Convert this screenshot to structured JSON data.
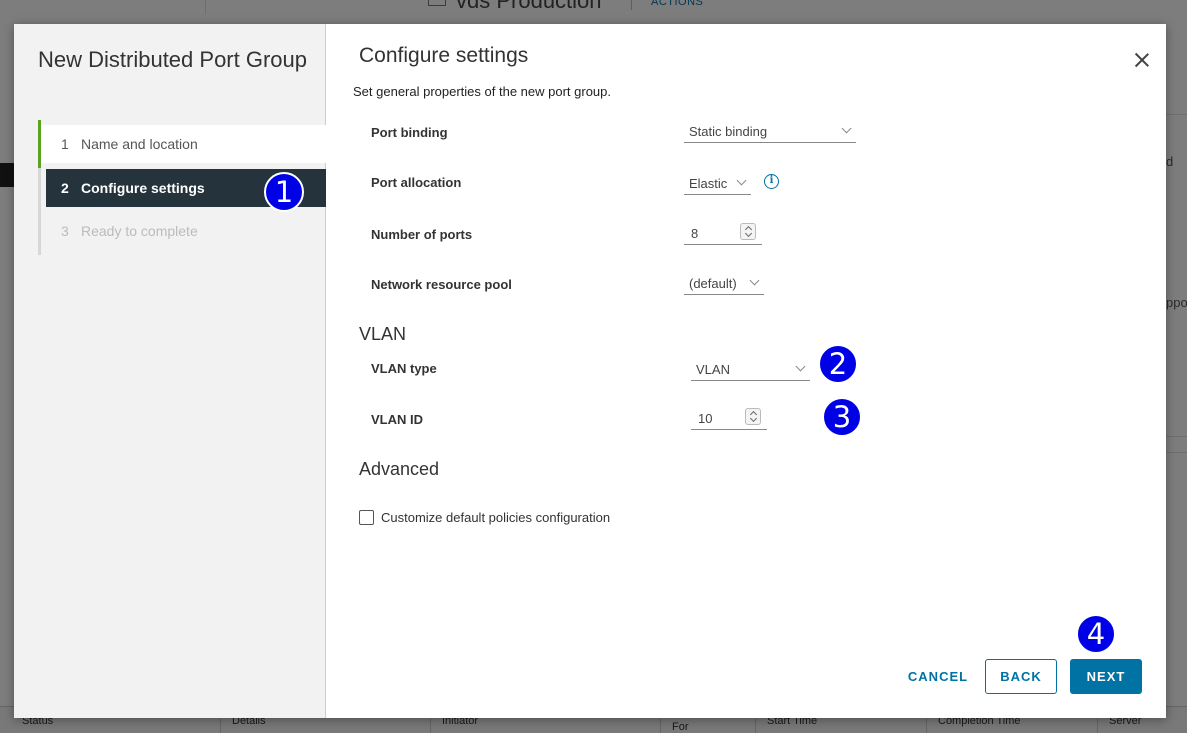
{
  "background": {
    "page_title": "vds Production",
    "actions_label": "ACTIONS",
    "right_text_1": "d",
    "right_text_2": "ppo",
    "table_headers": [
      "Status",
      "Details",
      "Initiator",
      "For",
      "Start Time",
      "Completion Time",
      "Server"
    ]
  },
  "wizard": {
    "title": "New Distributed Port Group",
    "steps": [
      {
        "num": "1",
        "label": "Name and location",
        "state": "done"
      },
      {
        "num": "2",
        "label": "Configure settings",
        "state": "active"
      },
      {
        "num": "3",
        "label": "Ready to complete",
        "state": "disabled"
      }
    ]
  },
  "main": {
    "title": "Configure settings",
    "subtitle": "Set general properties of the new port group.",
    "fields": {
      "port_binding": {
        "label": "Port binding",
        "value": "Static binding"
      },
      "port_allocation": {
        "label": "Port allocation",
        "value": "Elastic"
      },
      "number_of_ports": {
        "label": "Number of ports",
        "value": "8"
      },
      "network_resource_pool": {
        "label": "Network resource pool",
        "value": "(default)"
      }
    },
    "vlan": {
      "section_title": "VLAN",
      "vlan_type": {
        "label": "VLAN type",
        "value": "VLAN"
      },
      "vlan_id": {
        "label": "VLAN ID",
        "value": "10"
      }
    },
    "advanced": {
      "section_title": "Advanced",
      "customize_label": "Customize default policies configuration",
      "customize_checked": false
    },
    "buttons": {
      "cancel": "CANCEL",
      "back": "BACK",
      "next": "NEXT"
    }
  },
  "callouts": [
    "1",
    "2",
    "3",
    "4"
  ],
  "colors": {
    "accent": "#0072a3",
    "active_step_bg": "#25333d",
    "done_step_marker": "#5aa220",
    "callout": "#0000e6"
  }
}
